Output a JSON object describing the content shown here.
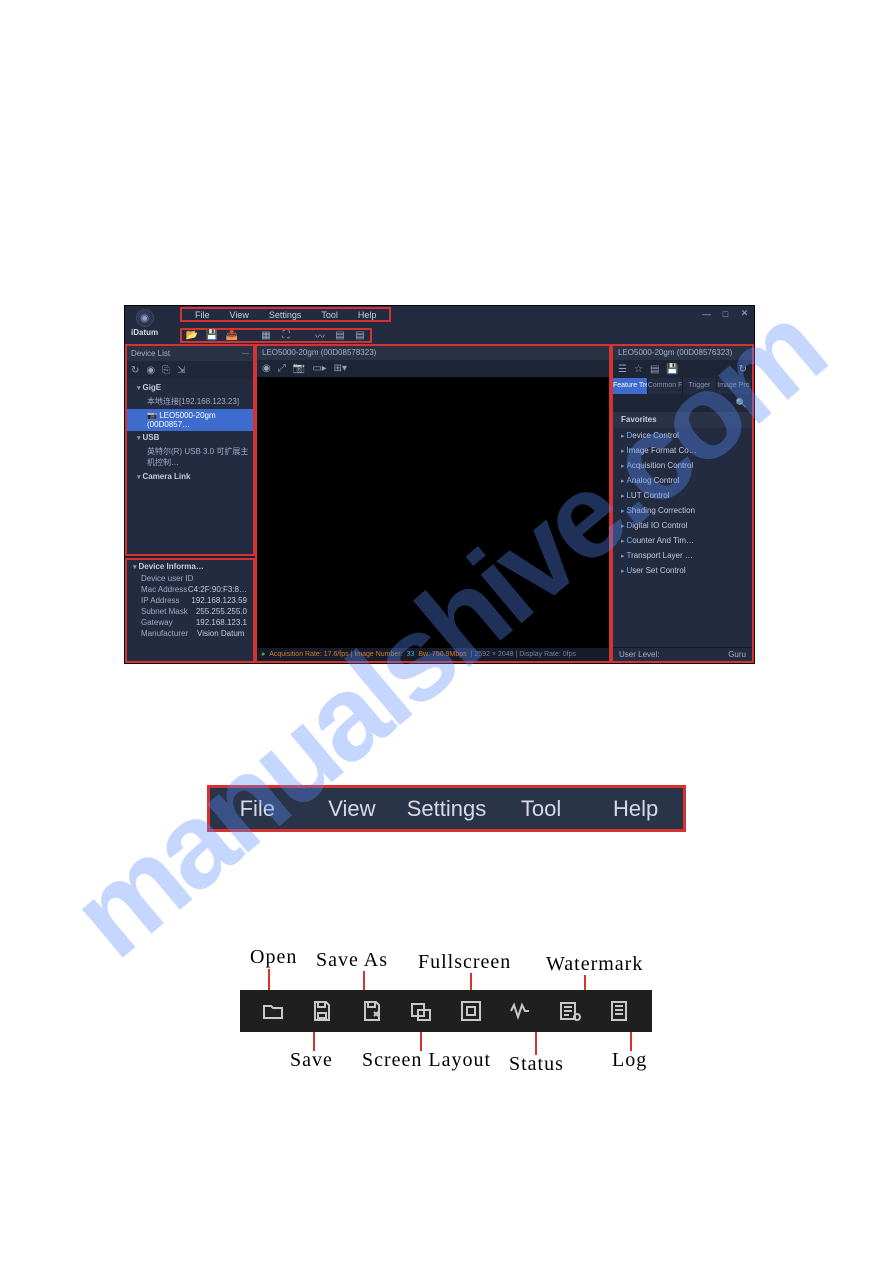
{
  "app_name": "iDatum",
  "menu": {
    "file": "File",
    "view": "View",
    "settings": "Settings",
    "tool": "Tool",
    "help": "Help"
  },
  "device_list": {
    "title": "Device List",
    "gige": "GigE",
    "gige_host": "本地连接[192.168.123.23]",
    "gige_cam": "LEO5000-20gm (00D0857…",
    "usb": "USB",
    "usb_host": "英特尔(R) USB 3.0 可扩展主机控制…",
    "camlink": "Camera Link"
  },
  "device_info": {
    "title": "Device Informa…",
    "rows": [
      {
        "k": "Device user ID",
        "v": ""
      },
      {
        "k": "Mac Address",
        "v": "C4:2F:90:F3:8…"
      },
      {
        "k": "IP Address",
        "v": "192.168.123.59"
      },
      {
        "k": "Subnet Mask",
        "v": "255.255.255.0"
      },
      {
        "k": "Gateway",
        "v": "192.168.123.1"
      },
      {
        "k": "Manufacturer",
        "v": "Vision Datum"
      }
    ]
  },
  "viewer": {
    "tab": "LEO5000-20gm (00D08578323)",
    "status_pre": "Acquisition Rate: 17.6/fps | Image Number:",
    "status_num": "33",
    "status_bw": "Bw: 750.9Mbps",
    "status_res": "| 2592 × 2048 | Display Rate: 0fps"
  },
  "feature_panel": {
    "title": "LEO5000-20gm (00D08576323)",
    "tabs": {
      "t1": "Feature Tree",
      "t2": "Common F…",
      "t3": "Trigger",
      "t4": "Image Pro…"
    },
    "favorites": "Favorites",
    "cats": [
      "Device Control",
      "Image Format Co…",
      "Acquisition Control",
      "Analog Control",
      "LUT Control",
      "Shading Correction",
      "Digital IO Control",
      "Counter And Tim…",
      "Transport Layer …",
      "User Set Control"
    ],
    "userlevel_k": "User Level:",
    "userlevel_v": "Guru"
  },
  "big_toolbar_labels": {
    "open": "Open",
    "save": "Save",
    "saveas": "Save As",
    "layout": "Screen Layout",
    "fullscreen": "Fullscreen",
    "status": "Status",
    "watermark": "Watermark",
    "log": "Log"
  },
  "watermark_text": "manualshive.com"
}
